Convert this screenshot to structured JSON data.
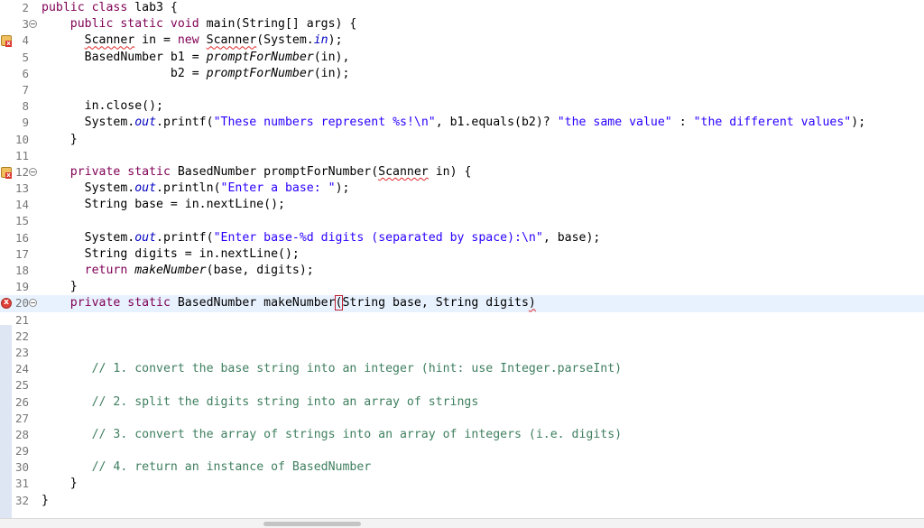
{
  "editor": {
    "lines": [
      {
        "num": "2",
        "fold": false,
        "marker": "",
        "current": false,
        "segments": [
          [
            "kw",
            "public class "
          ],
          [
            "",
            "lab3 {"
          ]
        ]
      },
      {
        "num": "3",
        "fold": true,
        "marker": "",
        "current": false,
        "segments": [
          [
            "",
            "    "
          ],
          [
            "kw",
            "public static void "
          ],
          [
            "",
            "main(String[] args) {"
          ]
        ]
      },
      {
        "num": "4",
        "fold": false,
        "marker": "warn-err",
        "current": false,
        "segments": [
          [
            "",
            "      "
          ],
          [
            "squig",
            "Scanner"
          ],
          [
            "",
            " in = "
          ],
          [
            "kw",
            "new "
          ],
          [
            "squig",
            "Scanner"
          ],
          [
            "",
            "(System."
          ],
          [
            "field",
            "in"
          ],
          [
            "",
            ");"
          ]
        ]
      },
      {
        "num": "5",
        "fold": false,
        "marker": "",
        "current": false,
        "segments": [
          [
            "",
            "      BasedNumber b1 = "
          ],
          [
            "call",
            "promptForNumber"
          ],
          [
            "",
            "(in),"
          ]
        ]
      },
      {
        "num": "6",
        "fold": false,
        "marker": "",
        "current": false,
        "segments": [
          [
            "",
            "                  b2 = "
          ],
          [
            "call",
            "promptForNumber"
          ],
          [
            "",
            "(in);"
          ]
        ]
      },
      {
        "num": "7",
        "fold": false,
        "marker": "",
        "current": false,
        "segments": []
      },
      {
        "num": "8",
        "fold": false,
        "marker": "",
        "current": false,
        "segments": [
          [
            "",
            "      in.close();"
          ]
        ]
      },
      {
        "num": "9",
        "fold": false,
        "marker": "",
        "current": false,
        "segments": [
          [
            "",
            "      System."
          ],
          [
            "field",
            "out"
          ],
          [
            "",
            ".printf("
          ],
          [
            "str",
            "\"These numbers represent %s!\\n\""
          ],
          [
            "",
            ", b1.equals(b2)? "
          ],
          [
            "str",
            "\"the same value\""
          ],
          [
            "",
            " : "
          ],
          [
            "str",
            "\"the different values\""
          ],
          [
            "",
            ");"
          ]
        ]
      },
      {
        "num": "10",
        "fold": false,
        "marker": "",
        "current": false,
        "segments": [
          [
            "",
            "    }"
          ]
        ]
      },
      {
        "num": "11",
        "fold": false,
        "marker": "",
        "current": false,
        "segments": []
      },
      {
        "num": "12",
        "fold": true,
        "marker": "warn-err",
        "current": false,
        "segments": [
          [
            "",
            "    "
          ],
          [
            "kw",
            "private static "
          ],
          [
            "",
            "BasedNumber promptForNumber("
          ],
          [
            "squig",
            "Scanner"
          ],
          [
            "",
            " in) {"
          ]
        ]
      },
      {
        "num": "13",
        "fold": false,
        "marker": "",
        "current": false,
        "segments": [
          [
            "",
            "      System."
          ],
          [
            "field",
            "out"
          ],
          [
            "",
            ".println("
          ],
          [
            "str",
            "\"Enter a base: \""
          ],
          [
            "",
            ");"
          ]
        ]
      },
      {
        "num": "14",
        "fold": false,
        "marker": "",
        "current": false,
        "segments": [
          [
            "",
            "      String base = in.nextLine();"
          ]
        ]
      },
      {
        "num": "15",
        "fold": false,
        "marker": "",
        "current": false,
        "segments": []
      },
      {
        "num": "16",
        "fold": false,
        "marker": "",
        "current": false,
        "segments": [
          [
            "",
            "      System."
          ],
          [
            "field",
            "out"
          ],
          [
            "",
            ".printf("
          ],
          [
            "str",
            "\"Enter base-%d digits (separated by space):\\n\""
          ],
          [
            "",
            ", base);"
          ]
        ]
      },
      {
        "num": "17",
        "fold": false,
        "marker": "",
        "current": false,
        "segments": [
          [
            "",
            "      String digits = in.nextLine();"
          ]
        ]
      },
      {
        "num": "18",
        "fold": false,
        "marker": "",
        "current": false,
        "segments": [
          [
            "",
            "      "
          ],
          [
            "kw",
            "return "
          ],
          [
            "call",
            "makeNumber"
          ],
          [
            "",
            "(base, digits);"
          ]
        ]
      },
      {
        "num": "19",
        "fold": false,
        "marker": "",
        "current": false,
        "segments": [
          [
            "",
            "    }"
          ]
        ]
      },
      {
        "num": "20",
        "fold": true,
        "marker": "err",
        "current": true,
        "segments": [
          [
            "",
            "    "
          ],
          [
            "kw",
            "private static "
          ],
          [
            "",
            "BasedNumber makeNumber"
          ],
          [
            "cursor",
            "("
          ],
          [
            "",
            "String base, String digits"
          ],
          [
            "squig",
            ")"
          ]
        ]
      },
      {
        "num": "21",
        "fold": false,
        "marker": "",
        "current": false,
        "segments": []
      },
      {
        "num": "22",
        "fold": false,
        "marker": "",
        "current": false,
        "segments": []
      },
      {
        "num": "23",
        "fold": false,
        "marker": "",
        "current": false,
        "segments": []
      },
      {
        "num": "24",
        "fold": false,
        "marker": "",
        "current": false,
        "segments": [
          [
            "",
            "       "
          ],
          [
            "cm",
            "// 1. convert the base string into an integer (hint: use Integer.parseInt)"
          ]
        ]
      },
      {
        "num": "25",
        "fold": false,
        "marker": "",
        "current": false,
        "segments": []
      },
      {
        "num": "26",
        "fold": false,
        "marker": "",
        "current": false,
        "segments": [
          [
            "",
            "       "
          ],
          [
            "cm",
            "// 2. split the digits string into an array of strings"
          ]
        ]
      },
      {
        "num": "27",
        "fold": false,
        "marker": "",
        "current": false,
        "segments": []
      },
      {
        "num": "28",
        "fold": false,
        "marker": "",
        "current": false,
        "segments": [
          [
            "",
            "       "
          ],
          [
            "cm",
            "// 3. convert the array of strings into an array of integers (i.e. digits)"
          ]
        ]
      },
      {
        "num": "29",
        "fold": false,
        "marker": "",
        "current": false,
        "segments": []
      },
      {
        "num": "30",
        "fold": false,
        "marker": "",
        "current": false,
        "segments": [
          [
            "",
            "       "
          ],
          [
            "cm",
            "// 4. return an instance of BasedNumber"
          ]
        ]
      },
      {
        "num": "31",
        "fold": false,
        "marker": "",
        "current": false,
        "segments": [
          [
            "",
            "    }"
          ]
        ]
      },
      {
        "num": "32",
        "fold": false,
        "marker": "",
        "current": false,
        "segments": [
          [
            "",
            "}"
          ]
        ]
      }
    ]
  },
  "colors": {
    "keyword": "#7f0055",
    "string": "#2a00ff",
    "comment": "#3f7f5f",
    "static_field": "#0000c0",
    "current_line": "#e8f2fe",
    "error_underline": "#e0282a"
  },
  "icons": {
    "warning_error_marker": "warning-error-icon",
    "error_marker": "error-icon",
    "fold_toggle": "fold-collapse-icon"
  }
}
